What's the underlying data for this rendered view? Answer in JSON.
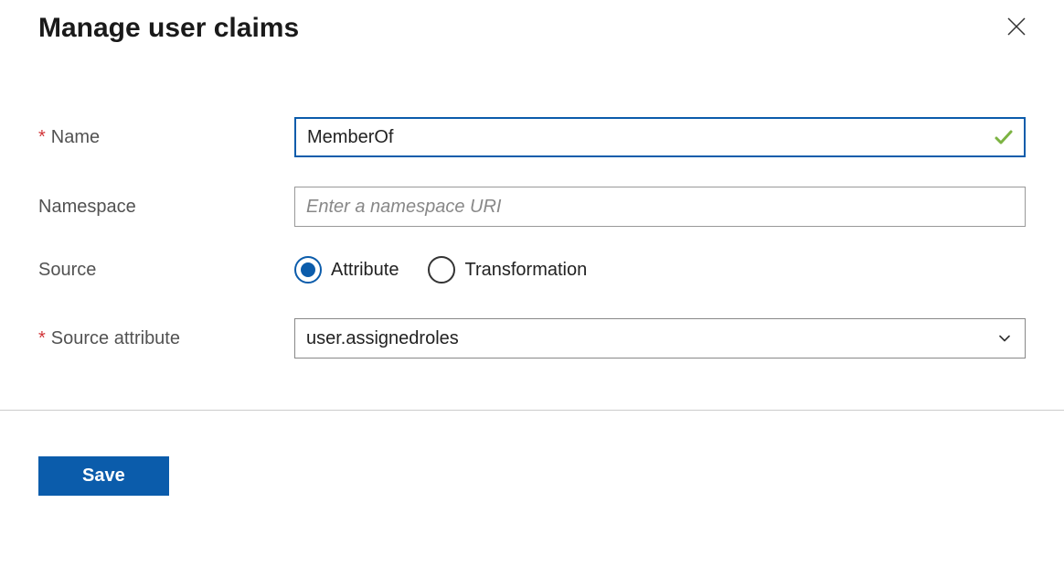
{
  "header": {
    "title": "Manage user claims"
  },
  "form": {
    "name": {
      "label": "Name",
      "value": "MemberOf",
      "required": true
    },
    "namespace": {
      "label": "Namespace",
      "placeholder": "Enter a namespace URI",
      "value": ""
    },
    "source": {
      "label": "Source",
      "options": {
        "attribute": "Attribute",
        "transformation": "Transformation"
      },
      "selected": "attribute"
    },
    "sourceAttribute": {
      "label": "Source attribute",
      "value": "user.assignedroles",
      "required": true
    }
  },
  "footer": {
    "save": "Save"
  }
}
